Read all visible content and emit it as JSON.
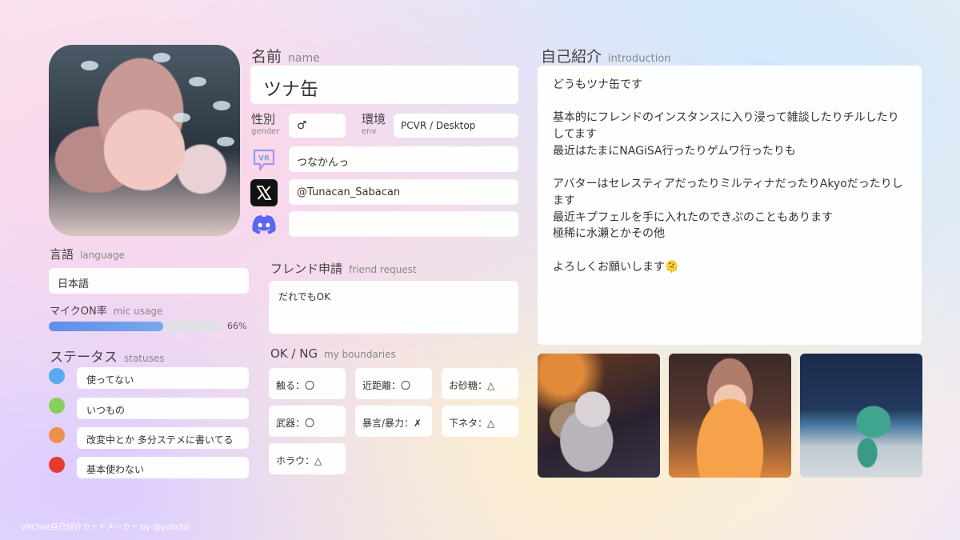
{
  "name": {
    "label_jp": "名前",
    "label_en": "name",
    "value": "ツナ缶"
  },
  "gender": {
    "label_jp": "性別",
    "label_en": "gender",
    "value": "♂"
  },
  "env": {
    "label_jp": "環境",
    "label_en": "env",
    "value": "PCVR / Desktop"
  },
  "accounts": {
    "vrchat": "つなかんっ",
    "x": "@Tunacan_Sabacan",
    "discord": ""
  },
  "language": {
    "label_jp": "言語",
    "label_en": "language",
    "value": "日本語"
  },
  "mic": {
    "label_jp": "マイクON率",
    "label_en": "mic usage",
    "value": "66%",
    "percent": 66
  },
  "statuses": {
    "label_jp": "ステータス",
    "label_en": "statuses",
    "items": [
      {
        "color": "#5aa8ee",
        "text": "使ってない"
      },
      {
        "color": "#86d15a",
        "text": "いつもの"
      },
      {
        "color": "#f0904e",
        "text": "改変中とか 多分ステメに書いてる"
      },
      {
        "color": "#e63a2e",
        "text": "基本使わない"
      }
    ]
  },
  "friend_request": {
    "label_jp": "フレンド申請",
    "label_en": "friend request",
    "value": "だれでもOK"
  },
  "boundaries": {
    "label_jp": "OK / NG",
    "label_en": "my boundaries",
    "items": [
      "触る：〇",
      "近距離：〇",
      "お砂糖：△",
      "武器：〇",
      "暴言/暴力：✗",
      "下ネタ：△",
      "ホラウ：△"
    ]
  },
  "intro": {
    "label_jp": "自己紹介",
    "label_en": "introduction",
    "text": "どうもツナ缶です\n\n基本的にフレンドのインスタンスに入り浸って雑談したりチルしたりしてます\n最近はたまにNAGiSA行ったりゲムワ行ったりも\n\nアバターはセレスティアだったりミルティナだったりAkyoだったりします\n最近キプフェルを手に入れたのできぷのこともあります\n極稀に水瀬とかその他\n\nよろしくお願いします🫠"
  },
  "footer": "VRChat自己紹介カードメーカー by @yota3d",
  "icons": {
    "vrchat": "vrchat-logo-icon",
    "x": "x-logo-icon",
    "discord": "discord-logo-icon"
  },
  "colors": {
    "mic_bar": "#5c8fe6",
    "discord": "#5865f2"
  }
}
